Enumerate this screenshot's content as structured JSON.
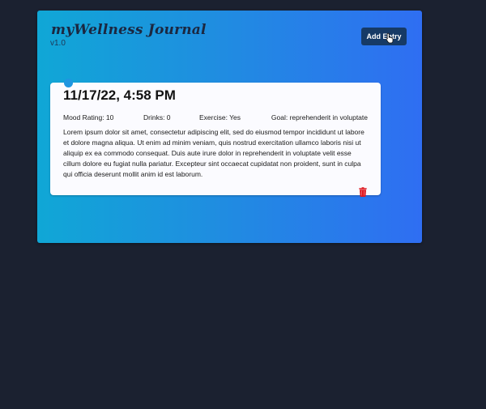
{
  "app": {
    "title": "myWellness Journal",
    "version": "v1.0",
    "add_entry_label": "Add Entry"
  },
  "entries": [
    {
      "datetime": "11/17/22, 4:58 PM",
      "mood": "Mood Rating: 10",
      "drinks": "Drinks: 0",
      "exercise": "Exercise: Yes",
      "goal": "Goal: reprehenderit in voluptate",
      "text": "Lorem ipsum dolor sit amet, consectetur adipiscing elit, sed do eiusmod tempor incididunt ut labore et dolore magna aliqua. Ut enim ad minim veniam, quis nostrud exercitation ullamco laboris nisi ut aliquip ex ea commodo consequat. Duis aute irure dolor in reprehenderit in voluptate velit esse cillum dolore eu fugiat nulla pariatur. Excepteur sint occaecat cupidatat non proident, sunt in culpa qui officia deserunt mollit anim id est laborum.",
      "delete_icon": "trash-icon"
    }
  ],
  "colors": {
    "page_background": "#1b2130",
    "panel_gradient_start": "#10a7d6",
    "panel_gradient_end": "#2f6ef2",
    "button": "#163a66",
    "delete": "#e0161e"
  }
}
